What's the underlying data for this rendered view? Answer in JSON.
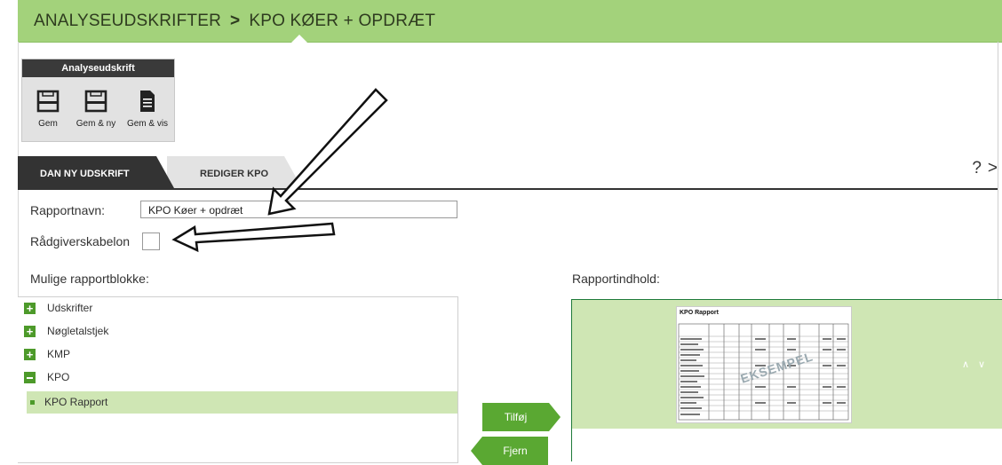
{
  "header": {
    "crumb1": "ANALYSEUDSKRIFTER",
    "separator": ">",
    "crumb2": "KPO KØER + OPDRÆT"
  },
  "ribbon": {
    "title": "Analyseudskrift",
    "buttons": [
      {
        "label": "Gem",
        "icon": "floppy-disk-icon"
      },
      {
        "label": "Gem & ny",
        "icon": "floppy-disk-icon"
      },
      {
        "label": "Gem & vis",
        "icon": "document-icon"
      }
    ]
  },
  "tabs": {
    "items": [
      {
        "label": "DAN NY UDSKRIFT",
        "active": true
      },
      {
        "label": "REDIGER KPO",
        "active": false
      }
    ],
    "help": "?",
    "more": ">"
  },
  "form": {
    "report_name_label": "Rapportnavn:",
    "report_name_value": "KPO Køer + opdræt",
    "advisor_template_label": "Rådgiverskabelon",
    "advisor_template_checked": false
  },
  "available": {
    "title": "Mulige rapportblokke:",
    "items": [
      {
        "label": "Udskrifter",
        "expanded": false
      },
      {
        "label": "Nøgletalstjek",
        "expanded": false
      },
      {
        "label": "KMP",
        "expanded": false
      },
      {
        "label": "KPO",
        "expanded": true
      }
    ],
    "child": {
      "label": "KPO Rapport",
      "selected": true
    }
  },
  "actions": {
    "add": "Tilføj",
    "remove": "Fjern"
  },
  "content": {
    "title": "Rapportindhold:",
    "preview_title": "KPO Rapport",
    "preview_watermark": "EKSEMPEL",
    "up": "∧",
    "down": "∨"
  },
  "colors": {
    "header_green": "#a3d27b",
    "button_green": "#5aa832",
    "selection_green": "#cfe6b4",
    "tab_dark": "#333333"
  }
}
